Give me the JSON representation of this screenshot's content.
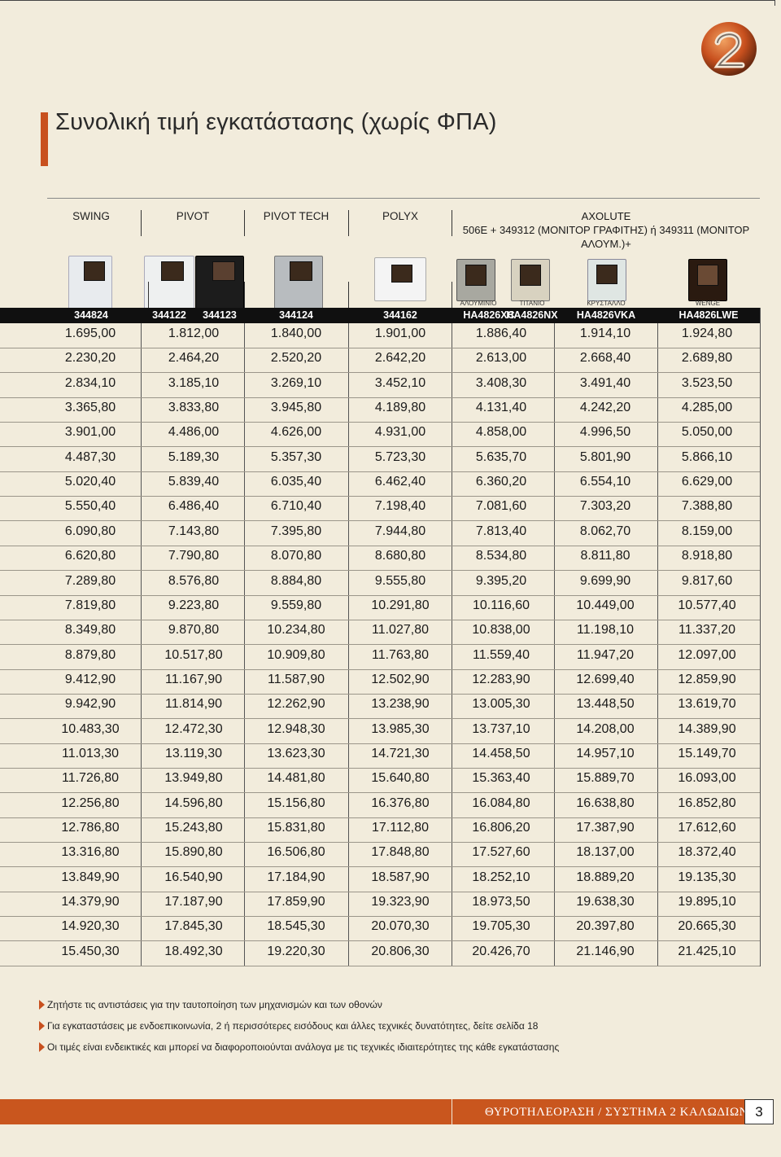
{
  "page": {
    "title": "Συνολική τιμή εγκατάστασης (χωρίς ΦΠΑ)",
    "page_number": "3",
    "footer": "ΘΥΡΟΤΗΛΕΟΡΑΣΗ / ΣΥΣΤΗΜΑ 2 ΚΑΛΩΔΙΩΝ",
    "logo_icon": "orange-2-wire-logo-icon"
  },
  "models": [
    {
      "name": "SWING"
    },
    {
      "name": "PIVOT"
    },
    {
      "name": "PIVOT TECH"
    },
    {
      "name": "POLYX"
    }
  ],
  "axolute": {
    "line1": "AXOLUTE",
    "line2": "506E + 349312 (ΜΟΝΙΤΟΡ ΓΡΑΦΙΤΗΣ) ή 349311 (ΜΟΝΙΤΟΡ ΑΛΟΥΜ.)+"
  },
  "finishes": [
    "ΑΛΟΥΜΙΝΙΟ",
    "ΤΙΤΑΝΙΟ",
    "ΚΡΥΣΤΑΛΛΟ",
    "WENGE"
  ],
  "codes": [
    "344824",
    "344122",
    "344123",
    "344124",
    "344162",
    "HA4826XC",
    "HA4826NX",
    "HA4826VKA",
    "HA4826LWE"
  ],
  "table": {
    "rows": [
      [
        "1.695,00",
        "1.812,00",
        "1.840,00",
        "1.901,00",
        "1.886,40",
        "1.914,10",
        "1.924,80"
      ],
      [
        "2.230,20",
        "2.464,20",
        "2.520,20",
        "2.642,20",
        "2.613,00",
        "2.668,40",
        "2.689,80"
      ],
      [
        "2.834,10",
        "3.185,10",
        "3.269,10",
        "3.452,10",
        "3.408,30",
        "3.491,40",
        "3.523,50"
      ],
      [
        "3.365,80",
        "3.833,80",
        "3.945,80",
        "4.189,80",
        "4.131,40",
        "4.242,20",
        "4.285,00"
      ],
      [
        "3.901,00",
        "4.486,00",
        "4.626,00",
        "4.931,00",
        "4.858,00",
        "4.996,50",
        "5.050,00"
      ],
      [
        "4.487,30",
        "5.189,30",
        "5.357,30",
        "5.723,30",
        "5.635,70",
        "5.801,90",
        "5.866,10"
      ],
      [
        "5.020,40",
        "5.839,40",
        "6.035,40",
        "6.462,40",
        "6.360,20",
        "6.554,10",
        "6.629,00"
      ],
      [
        "5.550,40",
        "6.486,40",
        "6.710,40",
        "7.198,40",
        "7.081,60",
        "7.303,20",
        "7.388,80"
      ],
      [
        "6.090,80",
        "7.143,80",
        "7.395,80",
        "7.944,80",
        "7.813,40",
        "8.062,70",
        "8.159,00"
      ],
      [
        "6.620,80",
        "7.790,80",
        "8.070,80",
        "8.680,80",
        "8.534,80",
        "8.811,80",
        "8.918,80"
      ],
      [
        "7.289,80",
        "8.576,80",
        "8.884,80",
        "9.555,80",
        "9.395,20",
        "9.699,90",
        "9.817,60"
      ],
      [
        "7.819,80",
        "9.223,80",
        "9.559,80",
        "10.291,80",
        "10.116,60",
        "10.449,00",
        "10.577,40"
      ],
      [
        "8.349,80",
        "9.870,80",
        "10.234,80",
        "11.027,80",
        "10.838,00",
        "11.198,10",
        "11.337,20"
      ],
      [
        "8.879,80",
        "10.517,80",
        "10.909,80",
        "11.763,80",
        "11.559,40",
        "11.947,20",
        "12.097,00"
      ],
      [
        "9.412,90",
        "11.167,90",
        "11.587,90",
        "12.502,90",
        "12.283,90",
        "12.699,40",
        "12.859,90"
      ],
      [
        "9.942,90",
        "11.814,90",
        "12.262,90",
        "13.238,90",
        "13.005,30",
        "13.448,50",
        "13.619,70"
      ],
      [
        "10.483,30",
        "12.472,30",
        "12.948,30",
        "13.985,30",
        "13.737,10",
        "14.208,00",
        "14.389,90"
      ],
      [
        "11.013,30",
        "13.119,30",
        "13.623,30",
        "14.721,30",
        "14.458,50",
        "14.957,10",
        "15.149,70"
      ],
      [
        "11.726,80",
        "13.949,80",
        "14.481,80",
        "15.640,80",
        "15.363,40",
        "15.889,70",
        "16.093,00"
      ],
      [
        "12.256,80",
        "14.596,80",
        "15.156,80",
        "16.376,80",
        "16.084,80",
        "16.638,80",
        "16.852,80"
      ],
      [
        "12.786,80",
        "15.243,80",
        "15.831,80",
        "17.112,80",
        "16.806,20",
        "17.387,90",
        "17.612,60"
      ],
      [
        "13.316,80",
        "15.890,80",
        "16.506,80",
        "17.848,80",
        "17.527,60",
        "18.137,00",
        "18.372,40"
      ],
      [
        "13.849,90",
        "16.540,90",
        "17.184,90",
        "18.587,90",
        "18.252,10",
        "18.889,20",
        "19.135,30"
      ],
      [
        "14.379,90",
        "17.187,90",
        "17.859,90",
        "19.323,90",
        "18.973,50",
        "19.638,30",
        "19.895,10"
      ],
      [
        "14.920,30",
        "17.845,30",
        "18.545,30",
        "20.070,30",
        "19.705,30",
        "20.397,80",
        "20.665,30"
      ],
      [
        "15.450,30",
        "18.492,30",
        "19.220,30",
        "20.806,30",
        "20.426,70",
        "21.146,90",
        "21.425,10"
      ]
    ]
  },
  "notes": [
    "Ζητήστε τις αντιστάσεις για την ταυτοποίηση των μηχανισμών και των οθονών",
    "Για εγκαταστάσεις με ενδοεπικοινωνία, 2 ή περισσότερες εισόδους και άλλες τεχνικές δυνατότητες, δείτε σελίδα 18",
    "Οι τιμές είναι ενδεικτικές και μπορεί να διαφοροποιούνται ανάλογα με τις τεχνικές ιδιαιτερότητες της κάθε εγκατάστασης"
  ],
  "colors": {
    "accent": "#c8501e",
    "background": "#f2ecdc",
    "header_bar": "#101010"
  }
}
